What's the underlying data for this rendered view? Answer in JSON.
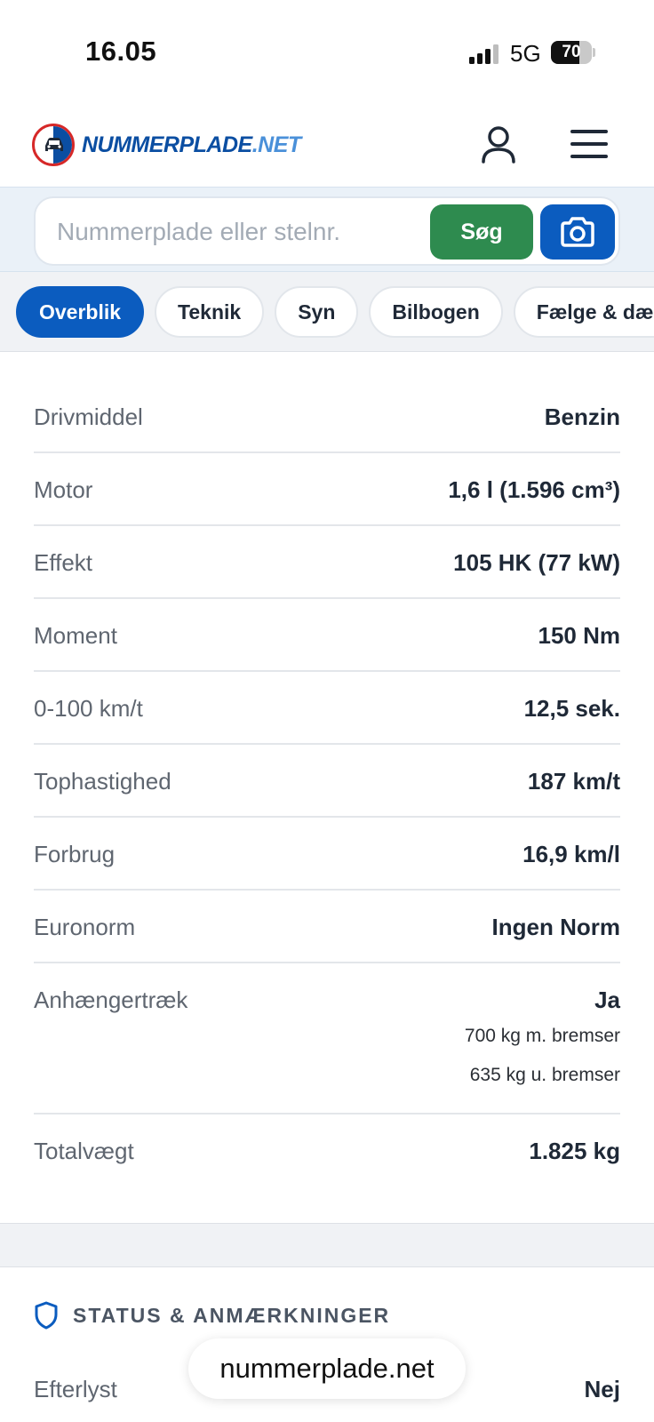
{
  "status_bar": {
    "time": "16.05",
    "network": "5G",
    "battery_percent": "70",
    "battery_level": 0.7,
    "signal_bars": 3
  },
  "header": {
    "logo_text": "NUMMERPLADE",
    "logo_suffix": ".NET",
    "user_icon": "user-icon",
    "menu_icon": "hamburger-menu-icon"
  },
  "search": {
    "placeholder": "Nummerplade eller stelnr.",
    "value": "",
    "button_label": "Søg",
    "camera_icon": "camera-icon"
  },
  "tabs": [
    {
      "label": "Overblik",
      "active": true
    },
    {
      "label": "Teknik",
      "active": false
    },
    {
      "label": "Syn",
      "active": false
    },
    {
      "label": "Bilbogen",
      "active": false
    },
    {
      "label": "Fælge & dæk",
      "active": false
    }
  ],
  "specs": [
    {
      "label": "Drivmiddel",
      "value": "Benzin"
    },
    {
      "label": "Motor",
      "value": "1,6 l (1.596 cm³)"
    },
    {
      "label": "Effekt",
      "value": "105 HK (77 kW)"
    },
    {
      "label": "Moment",
      "value": "150 Nm"
    },
    {
      "label": "0-100 km/t",
      "value": "12,5 sek."
    },
    {
      "label": "Tophastighed",
      "value": "187 km/t"
    },
    {
      "label": "Forbrug",
      "value": "16,9 km/l"
    },
    {
      "label": "Euronorm",
      "value": "Ingen Norm"
    },
    {
      "label": "Anhængertræk",
      "value": "Ja",
      "details": [
        "700 kg m. bremser",
        "635 kg u. bremser"
      ]
    },
    {
      "label": "Totalvægt",
      "value": "1.825 kg"
    }
  ],
  "status_section": {
    "icon": "shield-icon",
    "title": "STATUS & ANMÆRKNINGER",
    "rows": [
      {
        "label": "Efterlyst",
        "value": "Nej"
      }
    ]
  },
  "browser": {
    "url": "nummerplade.net"
  },
  "colors": {
    "primary_blue": "#0b5cbf",
    "search_green": "#2e8b4f",
    "logo_red": "#d62828",
    "band_bg": "#eaf1f8"
  }
}
